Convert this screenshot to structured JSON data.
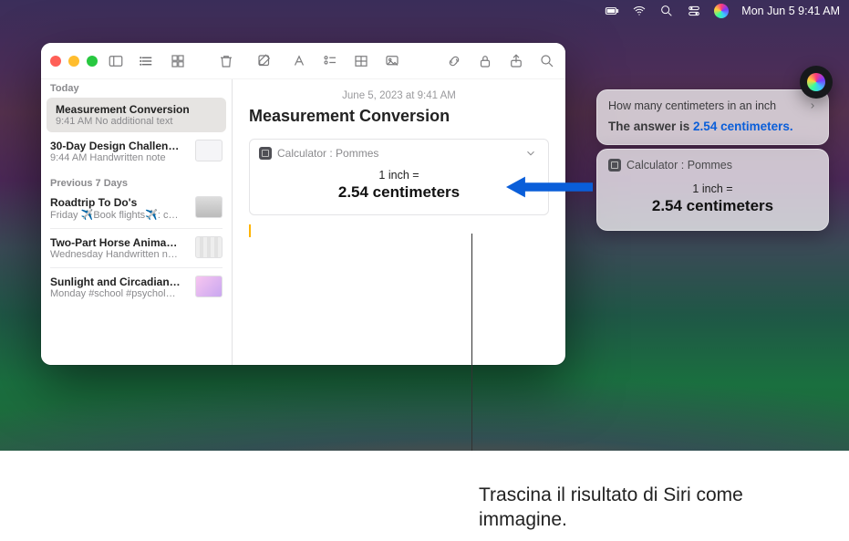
{
  "menubar": {
    "datetime": "Mon Jun 5  9:41 AM"
  },
  "notes": {
    "sidebar": {
      "section_today": "Today",
      "section_prev": "Previous 7 Days",
      "items": [
        {
          "title": "Measurement Conversion",
          "meta": "9:41 AM   No additional text"
        },
        {
          "title": "30-Day Design Challen…",
          "meta": "9:44 AM   Handwritten note"
        },
        {
          "title": "Roadtrip To Do's",
          "meta": "Friday   ✈️Book flights✈️: c…"
        },
        {
          "title": "Two-Part Horse Anima…",
          "meta": "Wednesday   Handwritten n…"
        },
        {
          "title": "Sunlight and Circadian…",
          "meta": "Monday   #school #psychol…"
        }
      ]
    },
    "editor": {
      "dateline": "June 5, 2023 at 9:41 AM",
      "title": "Measurement Conversion",
      "calc_source": "Calculator : Pommes",
      "inch_line": "1 inch =",
      "result_line": "2.54 centimeters"
    }
  },
  "siri": {
    "question": "How many centimeters in an inch",
    "answer_prefix": "The answer is ",
    "answer_value": "2.54 centimeters.",
    "calc_source": "Calculator : Pommes",
    "inch_line": "1 inch =",
    "result_line": "2.54 centimeters"
  },
  "callout": {
    "text": "Trascina il risultato di Siri come immagine."
  }
}
